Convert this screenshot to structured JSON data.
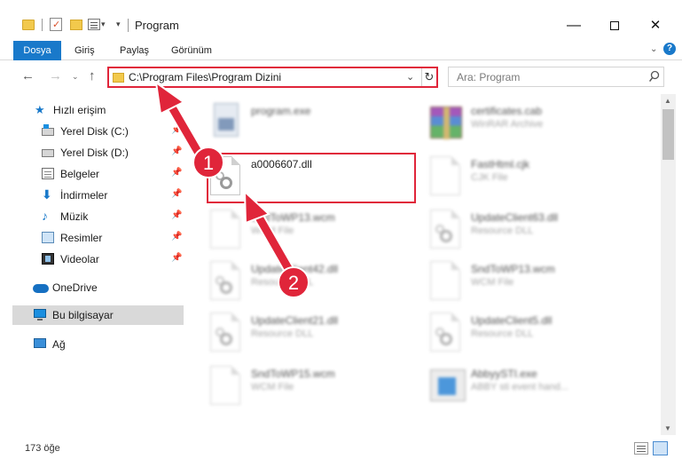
{
  "window": {
    "title": "Program",
    "minimize": "—",
    "close": "✕"
  },
  "ribbon": {
    "tabs": [
      "Dosya",
      "Giriş",
      "Paylaş",
      "Görünüm"
    ],
    "expand": "⌄",
    "help": "?"
  },
  "nav": {
    "back": "←",
    "forward": "→",
    "recent": "⌄",
    "up": "↑",
    "address": "C:\\Program Files\\Program Dizini",
    "address_dropdown": "⌄",
    "refresh": "↻",
    "search_placeholder": "Ara: Program"
  },
  "sidebar": {
    "items": [
      {
        "label": "Hızlı erişim",
        "icon": "star-icon"
      },
      {
        "label": "Yerel Disk (C:)",
        "icon": "drive-icon",
        "pinned": true
      },
      {
        "label": "Yerel Disk (D:)",
        "icon": "drive-icon",
        "pinned": true
      },
      {
        "label": "Belgeler",
        "icon": "documents-icon",
        "pinned": true
      },
      {
        "label": "İndirmeler",
        "icon": "download-icon",
        "pinned": true
      },
      {
        "label": "Müzik",
        "icon": "music-icon",
        "pinned": true
      },
      {
        "label": "Resimler",
        "icon": "pictures-icon",
        "pinned": true
      },
      {
        "label": "Videolar",
        "icon": "videos-icon",
        "pinned": true
      },
      {
        "label": "OneDrive",
        "icon": "cloud-icon"
      },
      {
        "label": "Bu bilgisayar",
        "icon": "computer-icon",
        "selected": true
      },
      {
        "label": "Ağ",
        "icon": "network-icon"
      }
    ],
    "pin_glyph": "📌"
  },
  "files": [
    {
      "name": "program.exe",
      "type": "",
      "icon": "program-icon"
    },
    {
      "name": "certificates.cab",
      "type": "WinRAR Archive",
      "icon": "winrar-icon"
    },
    {
      "name": "a0006607.dll",
      "type": "",
      "icon": "dll-file-icon",
      "highlighted": true
    },
    {
      "name": "FastHtml.cjk",
      "type": "CJK File",
      "icon": "file-icon"
    },
    {
      "name": "SndToWP13.wcm",
      "type": "WCM File",
      "icon": "file-icon"
    },
    {
      "name": "UpdateClient63.dll",
      "type": "Resource DLL",
      "icon": "dll-file-icon"
    },
    {
      "name": "UpdateClient42.dll",
      "type": "Resource DLL",
      "icon": "dll-file-icon"
    },
    {
      "name": "SndToWP13.wcm",
      "type": "WCM File",
      "icon": "file-icon"
    },
    {
      "name": "UpdateClient21.dll",
      "type": "Resource DLL",
      "icon": "dll-file-icon"
    },
    {
      "name": "UpdateClient5.dll",
      "type": "Resource DLL",
      "icon": "dll-file-icon"
    },
    {
      "name": "SndToWP15.wcm",
      "type": "WCM File",
      "icon": "file-icon"
    },
    {
      "name": "AbbyySTI.exe",
      "type": "ABBY sti event hand...",
      "icon": "exe-icon"
    }
  ],
  "status": {
    "count": "173 öğe"
  },
  "annotations": {
    "step1": "1",
    "step2": "2",
    "color": "#e0253a"
  }
}
